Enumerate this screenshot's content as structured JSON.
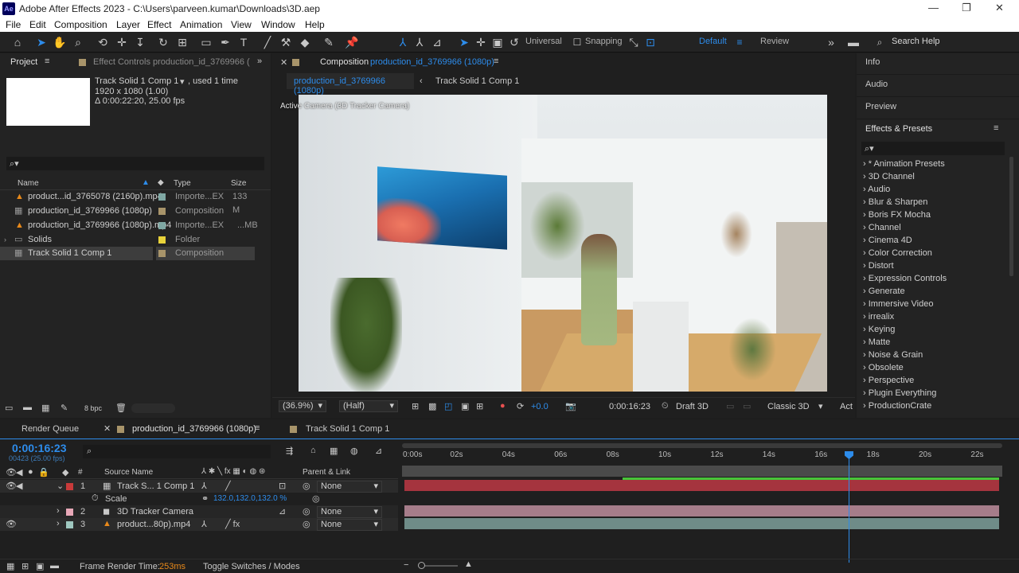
{
  "window": {
    "app_logo": "Ae",
    "title": "Adobe After Effects 2023 - C:\\Users\\parveen.kumar\\Downloads\\3D.aep",
    "minimize": "—",
    "maximize": "❐",
    "close": "✕"
  },
  "menu": [
    "File",
    "Edit",
    "Composition",
    "Layer",
    "Effect",
    "Animation",
    "View",
    "Window",
    "Help"
  ],
  "toolbar": {
    "universal": "Universal",
    "snapping": "Snapping",
    "workspace_default": "Default",
    "workspace_review": "Review",
    "search_help": "Search Help",
    "overflow": "»"
  },
  "project": {
    "tab": "Project",
    "effect_controls_tab": "Effect Controls production_id_3769966 (",
    "overflow": "»",
    "selected_name": "Track Solid 1 Comp 1",
    "used": ", used 1 time",
    "dims": "1920 x 1080 (1.00)",
    "duration": "Δ 0:00:22:20, 25.00 fps",
    "search_icon": "⌕▾",
    "columns": {
      "name": "Name",
      "type": "Type",
      "size": "Size"
    },
    "items": [
      {
        "name": "product...id_3765078 (2160p).mp4",
        "type": "Importe...EX",
        "size": "133 M",
        "color": "#7fa8a4",
        "icon": "footage-icon"
      },
      {
        "name": "production_id_3769966 (1080p)",
        "type": "Composition",
        "size": "",
        "color": "#a8946a",
        "icon": "composition-icon"
      },
      {
        "name": "production_id_3769966 (1080p).mp4",
        "type": "Importe...EX",
        "size": "...MB",
        "color": "#7fa8a4",
        "icon": "footage-icon"
      },
      {
        "name": "Solids",
        "type": "Folder",
        "size": "",
        "color": "#e8d23a",
        "icon": "folder-icon"
      },
      {
        "name": "Track Solid 1 Comp 1",
        "type": "Composition",
        "size": "",
        "color": "#a8946a",
        "icon": "composition-icon"
      }
    ],
    "bpc": "8 bpc"
  },
  "composition": {
    "prefix": "Composition",
    "tab": "production_id_3769966 (1080p)",
    "menu_icon": "≡",
    "sub_tab_active": "production_id_3769966 (1080p)",
    "sub_tab_other": "Track Solid 1 Comp 1",
    "camera_label": "Active Camera (3D Tracker Camera)",
    "zoom": "(36.9%)",
    "resolution": "(Half)",
    "exposure": "+0.0",
    "timecode": "0:00:16:23",
    "draft": "Draft 3D",
    "renderer": "Classic 3D",
    "view": "Act"
  },
  "right_panel": {
    "info": "Info",
    "audio": "Audio",
    "preview": "Preview",
    "effects_title": "Effects & Presets",
    "search_icon": "⌕▾",
    "categories": [
      "* Animation Presets",
      "3D Channel",
      "Audio",
      "Blur & Sharpen",
      "Boris FX Mocha",
      "Channel",
      "Cinema 4D",
      "Color Correction",
      "Distort",
      "Expression Controls",
      "Generate",
      "Immersive Video",
      "irrealix",
      "Keying",
      "Matte",
      "Noise & Grain",
      "Obsolete",
      "Perspective",
      "Plugin Everything",
      "ProductionCrate"
    ]
  },
  "timeline": {
    "render_queue_tab": "Render Queue",
    "comp_tab": "production_id_3769966 (1080p)",
    "other_tab": "Track Solid 1 Comp 1",
    "timecode": "0:00:16:23",
    "frame_info": "00423 (25.00 fps)",
    "search_icon": "⌕",
    "col_source": "Source Name",
    "col_parent": "Parent & Link",
    "ruler": [
      "0:00s",
      "02s",
      "04s",
      "06s",
      "08s",
      "10s",
      "12s",
      "14s",
      "16s",
      "18s",
      "20s",
      "22s"
    ],
    "current_time_fraction": 0.744,
    "layers": [
      {
        "num": "1",
        "name": "Track S... 1 Comp 1",
        "parent": "None",
        "color": "#c83a3a",
        "bar": "#a5343e"
      },
      {
        "num": "2",
        "name": "3D Tracker Camera",
        "parent": "None",
        "color": "#e8a8b8",
        "bar": "#a67d8a"
      },
      {
        "num": "3",
        "name": "product...80p).mp4",
        "parent": "None",
        "color": "#9fc8c0",
        "bar": "#6f8c88"
      }
    ],
    "scale_label": "Scale",
    "scale_value": "132.0,132.0,132.0 %",
    "frame_render_label": "Frame Render Time:",
    "frame_render_value": "253ms",
    "toggle": "Toggle Switches / Modes"
  },
  "colors": {
    "accent": "#2d8ceb",
    "panel": "#232323",
    "bg": "#1d1d1d"
  }
}
